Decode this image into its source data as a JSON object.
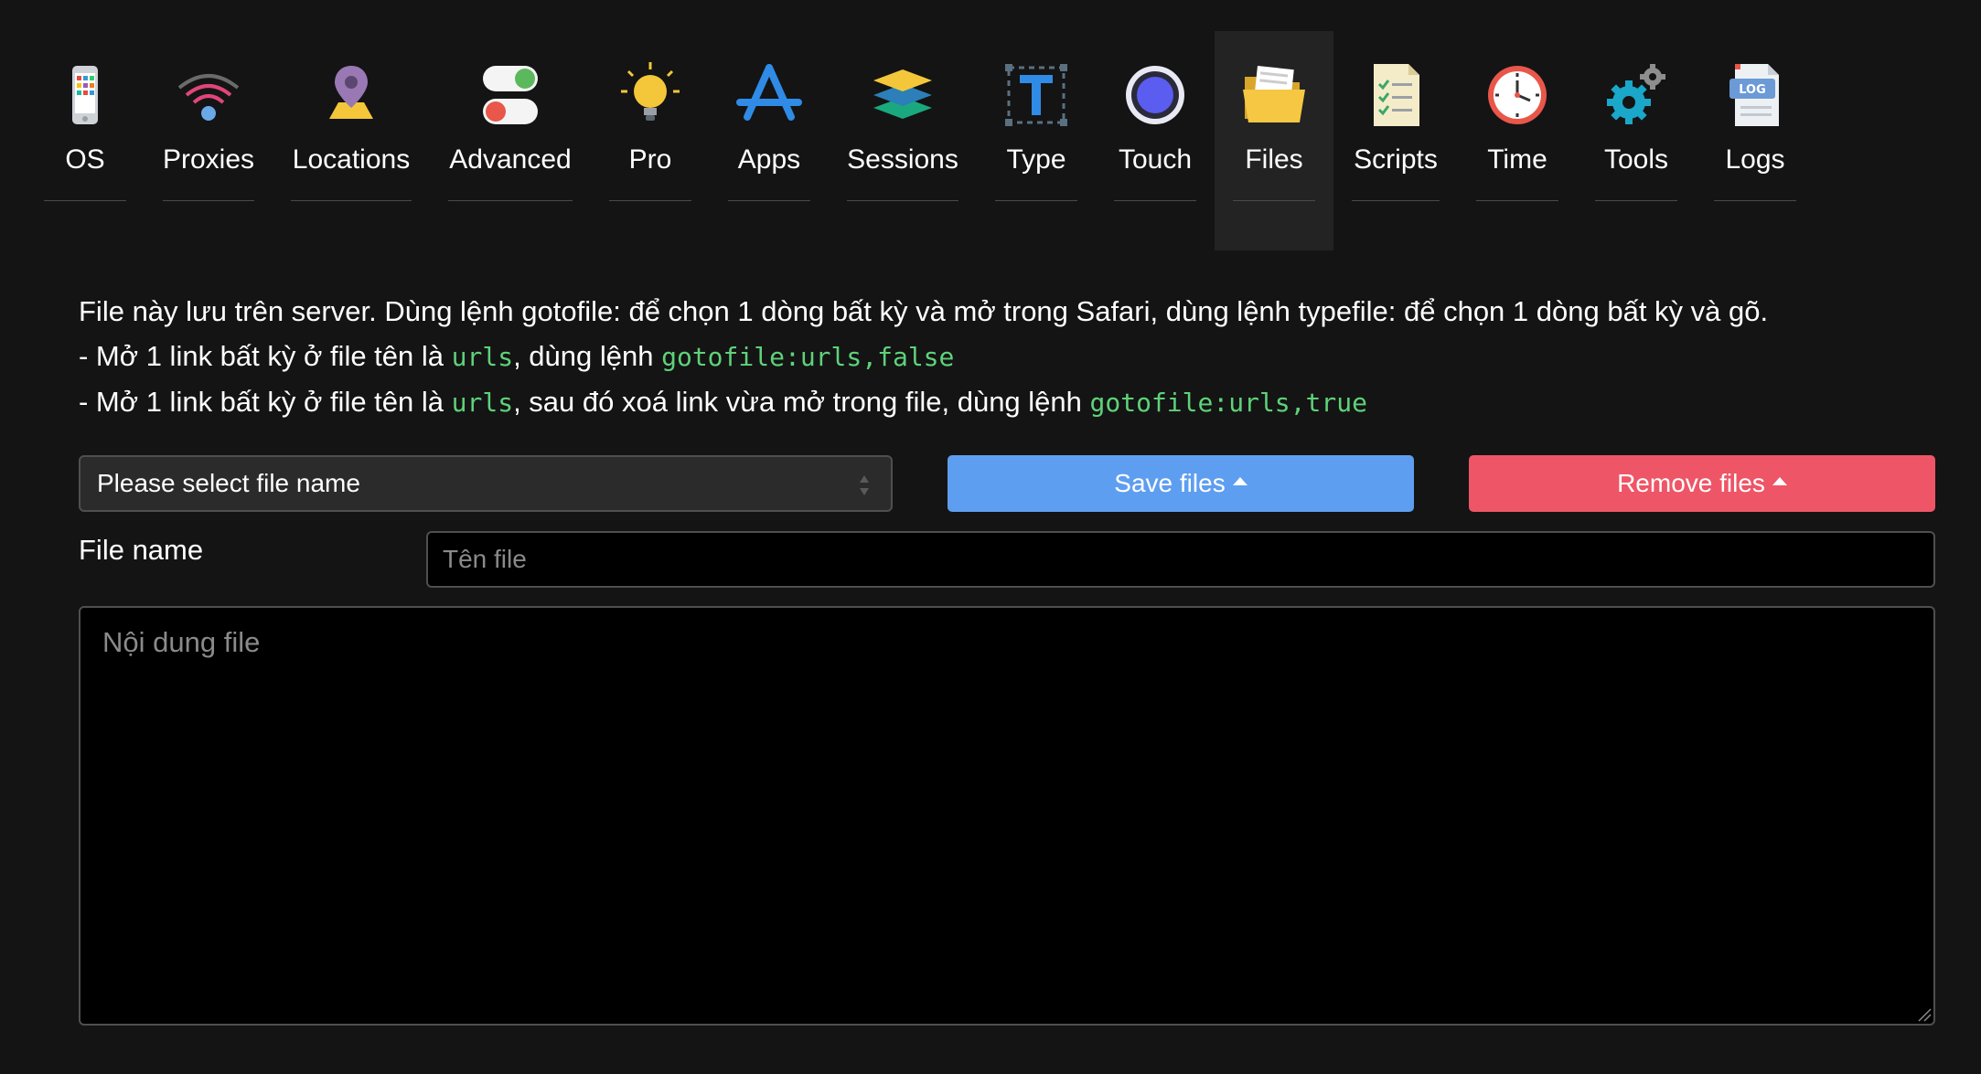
{
  "tabs": [
    {
      "id": "os",
      "label": "OS",
      "icon": "phone-icon"
    },
    {
      "id": "proxies",
      "label": "Proxies",
      "icon": "wifi-icon"
    },
    {
      "id": "locations",
      "label": "Locations",
      "icon": "map-pin-icon"
    },
    {
      "id": "advanced",
      "label": "Advanced",
      "icon": "toggles-icon"
    },
    {
      "id": "pro",
      "label": "Pro",
      "icon": "lightbulb-icon"
    },
    {
      "id": "apps",
      "label": "Apps",
      "icon": "app-store-icon"
    },
    {
      "id": "sessions",
      "label": "Sessions",
      "icon": "layers-icon"
    },
    {
      "id": "type",
      "label": "Type",
      "icon": "text-cursor-icon"
    },
    {
      "id": "touch",
      "label": "Touch",
      "icon": "touch-circle-icon"
    },
    {
      "id": "files",
      "label": "Files",
      "icon": "folder-icon",
      "active": true
    },
    {
      "id": "scripts",
      "label": "Scripts",
      "icon": "checklist-icon"
    },
    {
      "id": "time",
      "label": "Time",
      "icon": "clock-icon"
    },
    {
      "id": "tools",
      "label": "Tools",
      "icon": "gears-icon"
    },
    {
      "id": "logs",
      "label": "Logs",
      "icon": "log-file-icon"
    }
  ],
  "info": {
    "line1": "File này lưu trên server. Dùng lệnh gotofile: để chọn 1 dòng bất kỳ và mở trong Safari, dùng lệnh typefile: để chọn 1 dòng bất kỳ và gõ.",
    "line2_prefix": "- Mở 1 link bất kỳ ở file tên là ",
    "line2_code1": "urls",
    "line2_mid": ", dùng lệnh ",
    "line2_code2": "gotofile:urls,false",
    "line3_prefix": "- Mở 1 link bất kỳ ở file tên là ",
    "line3_code1": "urls",
    "line3_mid": ", sau đó xoá link vừa mở trong file, dùng lệnh ",
    "line3_code2": "gotofile:urls,true"
  },
  "file_select": {
    "value": "Please select file name"
  },
  "buttons": {
    "save": "Save files",
    "remove": "Remove files"
  },
  "file_name": {
    "label": "File name",
    "placeholder": "Tên file",
    "value": ""
  },
  "file_content": {
    "placeholder": "Nội dung file",
    "value": ""
  },
  "colors": {
    "background": "#141414",
    "active_tab": "#232323",
    "save": "#5e9ef0",
    "remove": "#ee5566",
    "code": "#5ed27a"
  }
}
